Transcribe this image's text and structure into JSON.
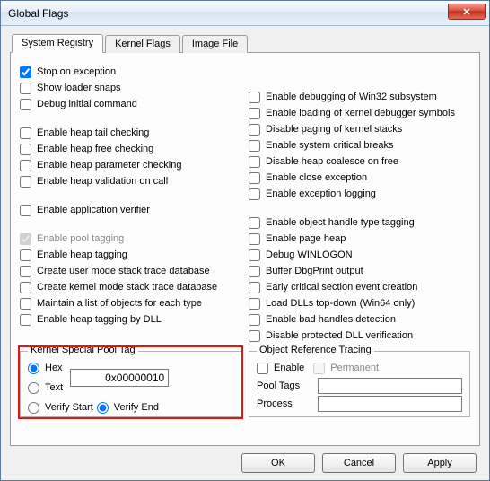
{
  "window": {
    "title": "Global Flags"
  },
  "tabs": [
    "System Registry",
    "Kernel Flags",
    "Image File"
  ],
  "active_tab": 0,
  "left_flags": [
    {
      "label": "Stop on exception",
      "checked": true
    },
    {
      "label": "Show loader snaps",
      "checked": false
    },
    {
      "label": "Debug initial command",
      "checked": false
    },
    null,
    {
      "label": "Enable heap tail checking",
      "checked": false
    },
    {
      "label": "Enable heap free checking",
      "checked": false
    },
    {
      "label": "Enable heap parameter checking",
      "checked": false
    },
    {
      "label": "Enable heap validation on call",
      "checked": false
    },
    null,
    {
      "label": "Enable application verifier",
      "checked": false
    },
    null,
    {
      "label": "Enable pool tagging",
      "checked": true,
      "disabled": true
    },
    {
      "label": "Enable heap tagging",
      "checked": false
    },
    {
      "label": "Create user mode stack trace database",
      "checked": false
    },
    {
      "label": "Create kernel mode stack trace database",
      "checked": false
    },
    {
      "label": "Maintain a list of objects for each type",
      "checked": false
    },
    {
      "label": "Enable heap tagging by DLL",
      "checked": false
    }
  ],
  "right_flags": [
    null,
    null,
    {
      "label": "Enable debugging of Win32 subsystem",
      "checked": false
    },
    {
      "label": "Enable loading of kernel debugger symbols",
      "checked": false
    },
    {
      "label": "Disable paging of kernel stacks",
      "checked": false
    },
    {
      "label": "Enable system critical breaks",
      "checked": false
    },
    {
      "label": "Disable heap coalesce on free",
      "checked": false
    },
    {
      "label": "Enable close exception",
      "checked": false
    },
    {
      "label": "Enable exception logging",
      "checked": false
    },
    null,
    {
      "label": "Enable object handle type tagging",
      "checked": false
    },
    {
      "label": "Enable page heap",
      "checked": false
    },
    {
      "label": "Debug WINLOGON",
      "checked": false
    },
    {
      "label": "Buffer DbgPrint output",
      "checked": false
    },
    {
      "label": "Early critical section event creation",
      "checked": false
    },
    {
      "label": "Load DLLs top-down (Win64 only)",
      "checked": false
    },
    {
      "label": "Enable bad handles detection",
      "checked": false
    },
    {
      "label": "Disable protected DLL verification",
      "checked": false
    }
  ],
  "kernel_pool": {
    "legend": "Kernel Special Pool Tag",
    "hex_label": "Hex",
    "text_label": "Text",
    "verify_start_label": "Verify Start",
    "verify_end_label": "Verify End",
    "mode": "hex",
    "verify": "end",
    "value": "0x00000010"
  },
  "ort": {
    "legend": "Object Reference Tracing",
    "enable_label": "Enable",
    "permanent_label": "Permanent",
    "pool_tags_label": "Pool Tags",
    "process_label": "Process",
    "enable": false,
    "permanent": false,
    "pool_tags": "",
    "process": ""
  },
  "buttons": {
    "ok": "OK",
    "cancel": "Cancel",
    "apply": "Apply"
  }
}
